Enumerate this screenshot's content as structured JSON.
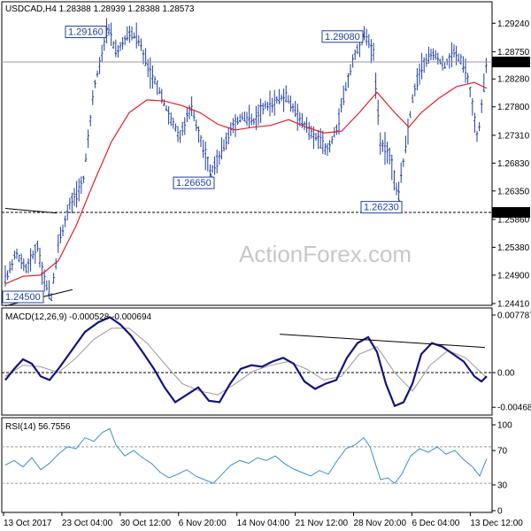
{
  "watermark": "ActionForex.com",
  "panels": {
    "price": {
      "header": "USDCAD,H4  1.28388 1.28939 1.28388 1.28573",
      "current_price_label": "1.28573",
      "level_label": "1.25980",
      "annotations": [
        "1.29160",
        "1.29080",
        "1.26650",
        "1.26230",
        "1.24500"
      ]
    },
    "macd": {
      "header": "MACD(12,26,9) -0.000528 -0.000694"
    },
    "rsi": {
      "header": "RSI(14) 56.7556"
    }
  },
  "colors": {
    "background": "#ffffff",
    "bars": "#1f3f9f",
    "moving_average": "#e0202a",
    "macd": "#14147a",
    "signal": "#9a9a9a",
    "rsi": "#3a8fd6",
    "grid": "#000000"
  },
  "chart_data": [
    {
      "type": "ohlc",
      "title": "USDCAD,H4",
      "symbol": "USDCAD",
      "timeframe": "H4",
      "last_bar": {
        "open": 1.28388,
        "high": 1.28939,
        "low": 1.28388,
        "close": 1.28573
      },
      "y_ticks": [
        "1.29240",
        "1.28750",
        "1.28280",
        "1.27800",
        "1.27310",
        "1.26830",
        "1.26350",
        "1.25860",
        "1.25380",
        "1.24900",
        "1.24410"
      ],
      "ylim": [
        1.2441,
        1.2958
      ],
      "x_ticks": [
        "13 Oct 2017",
        "23 Oct 04:00",
        "30 Oct 12:00",
        "6 Nov 20:00",
        "14 Nov 04:00",
        "21 Nov 12:00",
        "28 Nov 20:00",
        "6 Dec 04:00",
        "13 Dec 12:00"
      ],
      "price_path": [
        [
          0,
          1.248
        ],
        [
          12,
          1.2528
        ],
        [
          24,
          1.25
        ],
        [
          36,
          1.254
        ],
        [
          46,
          1.247
        ],
        [
          52,
          1.245
        ],
        [
          60,
          1.2545
        ],
        [
          72,
          1.261
        ],
        [
          88,
          1.265
        ],
        [
          100,
          1.281
        ],
        [
          110,
          1.288
        ],
        [
          116,
          1.2916
        ],
        [
          126,
          1.287
        ],
        [
          138,
          1.2905
        ],
        [
          150,
          1.29
        ],
        [
          162,
          1.2845
        ],
        [
          174,
          1.281
        ],
        [
          186,
          1.276
        ],
        [
          198,
          1.273
        ],
        [
          210,
          1.278
        ],
        [
          222,
          1.272
        ],
        [
          232,
          1.2665
        ],
        [
          244,
          1.27
        ],
        [
          256,
          1.2745
        ],
        [
          268,
          1.2765
        ],
        [
          280,
          1.2755
        ],
        [
          292,
          1.278
        ],
        [
          304,
          1.279
        ],
        [
          316,
          1.28
        ],
        [
          328,
          1.277
        ],
        [
          340,
          1.2745
        ],
        [
          352,
          1.2725
        ],
        [
          364,
          1.2705
        ],
        [
          374,
          1.274
        ],
        [
          386,
          1.282
        ],
        [
          396,
          1.2875
        ],
        [
          406,
          1.2906
        ],
        [
          416,
          1.287
        ],
        [
          424,
          1.272
        ],
        [
          434,
          1.27
        ],
        [
          444,
          1.2623
        ],
        [
          452,
          1.271
        ],
        [
          462,
          1.281
        ],
        [
          472,
          1.2855
        ],
        [
          484,
          1.287
        ],
        [
          496,
          1.285
        ],
        [
          506,
          1.2875
        ],
        [
          516,
          1.286
        ],
        [
          524,
          1.282
        ],
        [
          530,
          1.276
        ],
        [
          534,
          1.272
        ],
        [
          538,
          1.278
        ],
        [
          544,
          1.2857
        ]
      ],
      "ma_path": [
        [
          0,
          1.2475
        ],
        [
          20,
          1.2488
        ],
        [
          40,
          1.249
        ],
        [
          60,
          1.2515
        ],
        [
          80,
          1.2575
        ],
        [
          100,
          1.265
        ],
        [
          120,
          1.272
        ],
        [
          140,
          1.277
        ],
        [
          160,
          1.2792
        ],
        [
          180,
          1.279
        ],
        [
          200,
          1.2782
        ],
        [
          220,
          1.277
        ],
        [
          240,
          1.275
        ],
        [
          260,
          1.274
        ],
        [
          280,
          1.2745
        ],
        [
          300,
          1.2748
        ],
        [
          320,
          1.2758
        ],
        [
          340,
          1.2745
        ],
        [
          360,
          1.2735
        ],
        [
          380,
          1.2738
        ],
        [
          400,
          1.277
        ],
        [
          420,
          1.2805
        ],
        [
          440,
          1.277
        ],
        [
          456,
          1.2745
        ],
        [
          470,
          1.277
        ],
        [
          490,
          1.2795
        ],
        [
          510,
          1.2815
        ],
        [
          530,
          1.2822
        ],
        [
          544,
          1.2812
        ]
      ],
      "horizontal_level": 1.2598,
      "trendline": [
        [
          0,
          1.2605
        ],
        [
          58,
          1.2597
        ]
      ],
      "trendline_low": [
        [
          0,
          1.2437
        ],
        [
          76,
          1.2465
        ]
      ],
      "annotations": [
        {
          "label": "1.29160",
          "x": 116,
          "value": 1.2916,
          "anchor": "top"
        },
        {
          "label": "1.29080",
          "x": 406,
          "value": 1.2908,
          "anchor": "top"
        },
        {
          "label": "1.26650",
          "x": 232,
          "value": 1.2665,
          "anchor": "bottom"
        },
        {
          "label": "1.26230",
          "x": 444,
          "value": 1.2623,
          "anchor": "bottom"
        },
        {
          "label": "1.24500",
          "x": 30,
          "value": 1.245,
          "anchor": "bottom"
        }
      ]
    },
    {
      "type": "line",
      "title": "MACD(12,26,9)",
      "values": {
        "macd": -0.000528,
        "signal": -0.000694
      },
      "y_ticks": [
        "0.007787",
        "0.00",
        "-0.004688"
      ],
      "ylim": [
        -0.0055,
        0.0085
      ],
      "zero_level": 0,
      "series": [
        {
          "name": "MACD",
          "points": [
            [
              0,
              -0.001
            ],
            [
              10,
              0.0005
            ],
            [
              20,
              0.0018
            ],
            [
              30,
              0.0012
            ],
            [
              40,
              -0.0005
            ],
            [
              50,
              -0.001
            ],
            [
              60,
              0.0005
            ],
            [
              75,
              0.003
            ],
            [
              90,
              0.0055
            ],
            [
              105,
              0.0068
            ],
            [
              118,
              0.0075
            ],
            [
              130,
              0.0065
            ],
            [
              142,
              0.005
            ],
            [
              155,
              0.0028
            ],
            [
              168,
              0.0005
            ],
            [
              180,
              -0.002
            ],
            [
              192,
              -0.004
            ],
            [
              205,
              -0.003
            ],
            [
              218,
              -0.002
            ],
            [
              230,
              -0.0038
            ],
            [
              242,
              -0.004
            ],
            [
              254,
              -0.0015
            ],
            [
              266,
              0.0005
            ],
            [
              278,
              0.001
            ],
            [
              290,
              0.0008
            ],
            [
              302,
              0.0015
            ],
            [
              314,
              0.002
            ],
            [
              326,
              0.0012
            ],
            [
              338,
              -0.0012
            ],
            [
              350,
              -0.0022
            ],
            [
              362,
              -0.0015
            ],
            [
              374,
              -0.001
            ],
            [
              386,
              0.002
            ],
            [
              398,
              0.004
            ],
            [
              410,
              0.0048
            ],
            [
              420,
              0.0028
            ],
            [
              430,
              -0.0015
            ],
            [
              440,
              -0.0045
            ],
            [
              450,
              -0.004
            ],
            [
              460,
              -0.0015
            ],
            [
              470,
              0.0025
            ],
            [
              482,
              0.004
            ],
            [
              494,
              0.0035
            ],
            [
              506,
              0.0025
            ],
            [
              518,
              0.0015
            ],
            [
              530,
              -0.0005
            ],
            [
              538,
              -0.0012
            ],
            [
              544,
              -0.0005
            ]
          ]
        },
        {
          "name": "Signal",
          "points": [
            [
              0,
              -0.0005
            ],
            [
              20,
              0.001
            ],
            [
              40,
              0.0008
            ],
            [
              60,
              0.0
            ],
            [
              80,
              0.002
            ],
            [
              100,
              0.0045
            ],
            [
              120,
              0.006
            ],
            [
              140,
              0.006
            ],
            [
              160,
              0.004
            ],
            [
              180,
              0.0012
            ],
            [
              200,
              -0.0015
            ],
            [
              220,
              -0.0025
            ],
            [
              240,
              -0.003
            ],
            [
              260,
              -0.0015
            ],
            [
              280,
              0.0002
            ],
            [
              300,
              0.001
            ],
            [
              320,
              0.0015
            ],
            [
              340,
              0.0005
            ],
            [
              360,
              -0.001
            ],
            [
              380,
              -0.0005
            ],
            [
              400,
              0.0025
            ],
            [
              420,
              0.0035
            ],
            [
              440,
              0.0
            ],
            [
              460,
              -0.0025
            ],
            [
              480,
              0.001
            ],
            [
              500,
              0.003
            ],
            [
              520,
              0.002
            ],
            [
              544,
              -0.0007
            ]
          ]
        }
      ],
      "trendline": [
        [
          310,
          0.0052
        ],
        [
          542,
          0.0034
        ]
      ]
    },
    {
      "type": "line",
      "title": "RSI(14)",
      "value": 56.7556,
      "y_ticks": [
        "100",
        "70",
        "30",
        "0"
      ],
      "ylim": [
        0,
        100
      ],
      "levels": [
        70,
        30
      ],
      "series": [
        {
          "name": "RSI",
          "points": [
            [
              0,
              50
            ],
            [
              10,
              55
            ],
            [
              20,
              48
            ],
            [
              30,
              58
            ],
            [
              40,
              45
            ],
            [
              50,
              52
            ],
            [
              60,
              62
            ],
            [
              70,
              70
            ],
            [
              80,
              68
            ],
            [
              90,
              80
            ],
            [
              100,
              76
            ],
            [
              110,
              86
            ],
            [
              118,
              90
            ],
            [
              125,
              72
            ],
            [
              135,
              60
            ],
            [
              145,
              66
            ],
            [
              155,
              58
            ],
            [
              165,
              52
            ],
            [
              175,
              42
            ],
            [
              185,
              36
            ],
            [
              195,
              40
            ],
            [
              205,
              45
            ],
            [
              215,
              38
            ],
            [
              225,
              34
            ],
            [
              235,
              30
            ],
            [
              245,
              40
            ],
            [
              255,
              50
            ],
            [
              265,
              55
            ],
            [
              275,
              52
            ],
            [
              285,
              58
            ],
            [
              295,
              55
            ],
            [
              305,
              60
            ],
            [
              315,
              52
            ],
            [
              325,
              46
            ],
            [
              335,
              42
            ],
            [
              345,
              38
            ],
            [
              355,
              44
            ],
            [
              365,
              40
            ],
            [
              375,
              55
            ],
            [
              385,
              68
            ],
            [
              395,
              72
            ],
            [
              405,
              80
            ],
            [
              412,
              70
            ],
            [
              418,
              52
            ],
            [
              424,
              34
            ],
            [
              432,
              36
            ],
            [
              440,
              30
            ],
            [
              448,
              40
            ],
            [
              458,
              60
            ],
            [
              468,
              68
            ],
            [
              478,
              64
            ],
            [
              488,
              70
            ],
            [
              498,
              62
            ],
            [
              508,
              66
            ],
            [
              518,
              56
            ],
            [
              528,
              48
            ],
            [
              536,
              38
            ],
            [
              544,
              57
            ]
          ]
        }
      ]
    }
  ]
}
